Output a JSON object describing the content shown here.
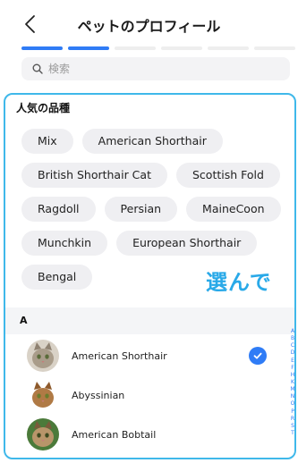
{
  "header": {
    "title": "ペットのプロフィール"
  },
  "progress": {
    "total_steps": 6,
    "completed_steps": 2
  },
  "search": {
    "placeholder": "検索",
    "value": ""
  },
  "popular": {
    "title": "人気の品種",
    "rows": [
      [
        "Mix",
        "American Shorthair"
      ],
      [
        "British Shorthair Cat",
        "Scottish Fold"
      ],
      [
        "Ragdoll",
        "Persian",
        "MaineCoon"
      ],
      [
        "Munchkin",
        "European Shorthair"
      ],
      [
        "Bengal"
      ]
    ]
  },
  "overlay": {
    "text": "選んで"
  },
  "breed_group": {
    "letter": "A"
  },
  "breeds": [
    {
      "name": "American Shorthair",
      "selected": true,
      "avatar": "cat-avatar-tabby"
    },
    {
      "name": "Abyssinian",
      "selected": false,
      "avatar": "cat-avatar-abyssinian"
    },
    {
      "name": "American Bobtail",
      "selected": false,
      "avatar": "cat-avatar-bobtail"
    }
  ],
  "index_letters": [
    "A",
    "B",
    "C",
    "D",
    "E",
    "F",
    "H",
    "K",
    "M",
    "N",
    "O",
    "P",
    "R",
    "S",
    "T"
  ],
  "colors": {
    "accent": "#2f7cf6",
    "highlight": "#3fb8ea",
    "chip_bg": "#efeff2"
  }
}
